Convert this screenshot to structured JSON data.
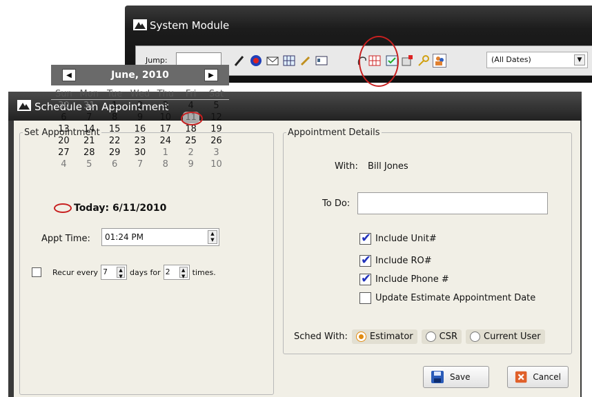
{
  "system_module": {
    "title": "System Module",
    "jump_label": "Jump:",
    "jump_value": "",
    "dates_select": "(All Dates)",
    "toolbar_icons": [
      "pen-icon",
      "circle-icon",
      "envelope-icon",
      "grid-icon",
      "wrench-icon",
      "card-icon",
      "lasso-icon",
      "calendar-grid-icon",
      "list-check-icon",
      "flag-board-icon",
      "key-icon",
      "people-icon"
    ]
  },
  "appointment": {
    "title": "Schedule an Appointment",
    "set_appointment_legend": "Set Appointment",
    "details_legend": "Appointment Details",
    "calendar": {
      "month_label": "June, 2010",
      "weekdays": [
        "Sun",
        "Mon",
        "Tue",
        "Wed",
        "Thu",
        "Fri",
        "Sat"
      ],
      "weeks": [
        [
          "30",
          "31",
          "1",
          "2",
          "3",
          "4",
          "5"
        ],
        [
          "6",
          "7",
          "8",
          "9",
          "10",
          "11",
          "12"
        ],
        [
          "13",
          "14",
          "15",
          "16",
          "17",
          "18",
          "19"
        ],
        [
          "20",
          "21",
          "22",
          "23",
          "24",
          "25",
          "26"
        ],
        [
          "27",
          "28",
          "29",
          "30",
          "1",
          "2",
          "3"
        ],
        [
          "4",
          "5",
          "6",
          "7",
          "8",
          "9",
          "10"
        ]
      ],
      "today_text": "Today: 6/11/2010"
    },
    "appt_time_label": "Appt Time:",
    "appt_time_value": "01:24 PM",
    "recur": {
      "prefix": "Recur every",
      "days_value": "7",
      "middle": "days for",
      "times_value": "2",
      "suffix": "times."
    },
    "with_label": "With:",
    "with_value": "Bill Jones",
    "todo_label": "To Do:",
    "todo_value": "",
    "checkboxes": [
      {
        "label": "Include Unit#",
        "checked": true
      },
      {
        "label": "Include RO#",
        "checked": true
      },
      {
        "label": "Include Phone #",
        "checked": true
      },
      {
        "label": "Update Estimate Appointment Date",
        "checked": false
      }
    ],
    "sched_with_label": "Sched With:",
    "sched_options": [
      {
        "label": "Estimator",
        "selected": true
      },
      {
        "label": "CSR",
        "selected": false
      },
      {
        "label": "Current User",
        "selected": false
      }
    ],
    "save_label": "Save",
    "cancel_label": "Cancel",
    "accent_color": "#c82020"
  }
}
